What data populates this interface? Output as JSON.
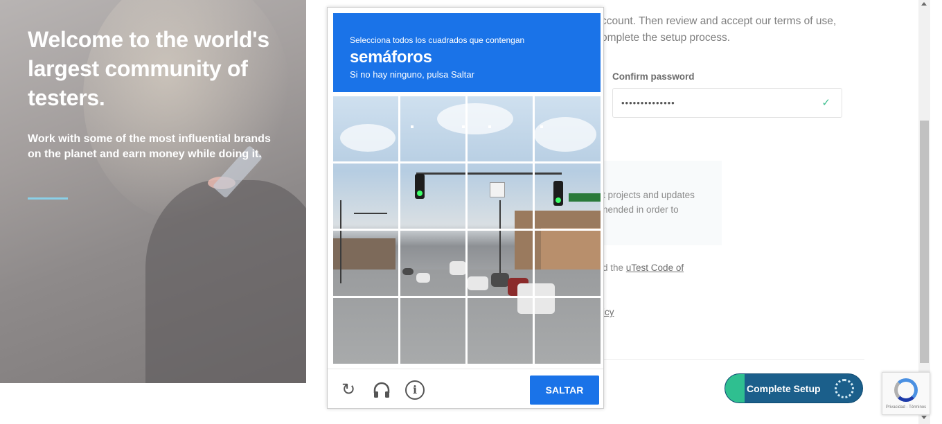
{
  "hero": {
    "heading": "Welcome to the world's largest community of testers.",
    "subheading": "Work with some of the most influential brands on the planet and earn money while doing it."
  },
  "form": {
    "intro_line1": "ccount. Then review and accept our terms of use,",
    "intro_line2": "omplete the setup process.",
    "confirm_password_label": "Confirm password",
    "confirm_password_value": "••••••••••••••",
    "panel_line1": "t projects and updates",
    "panel_line2": "nended in order to",
    "code_of_conduct_prefix": "d the ",
    "code_of_conduct_link": "uTest Code of",
    "privacy_fragment": "icy",
    "complete_setup_label": "Complete Setup"
  },
  "captcha": {
    "instruction": "Selecciona todos los cuadrados que contengan",
    "target": "semáforos",
    "hint": "Si no hay ninguno, pulsa Saltar",
    "skip_label": "SALTAR",
    "icons": [
      "reload-icon",
      "headphones-icon",
      "info-icon"
    ],
    "grid_size": "4x4"
  },
  "recaptcha_badge": {
    "footer_text": "Privacidad - Términos"
  },
  "colors": {
    "captcha_blue": "#1a73e8",
    "setup_button": "#1b5f8b",
    "setup_accent": "#2fbf90",
    "hero_rule": "#8ad0e8",
    "check": "#3fbf8f"
  }
}
